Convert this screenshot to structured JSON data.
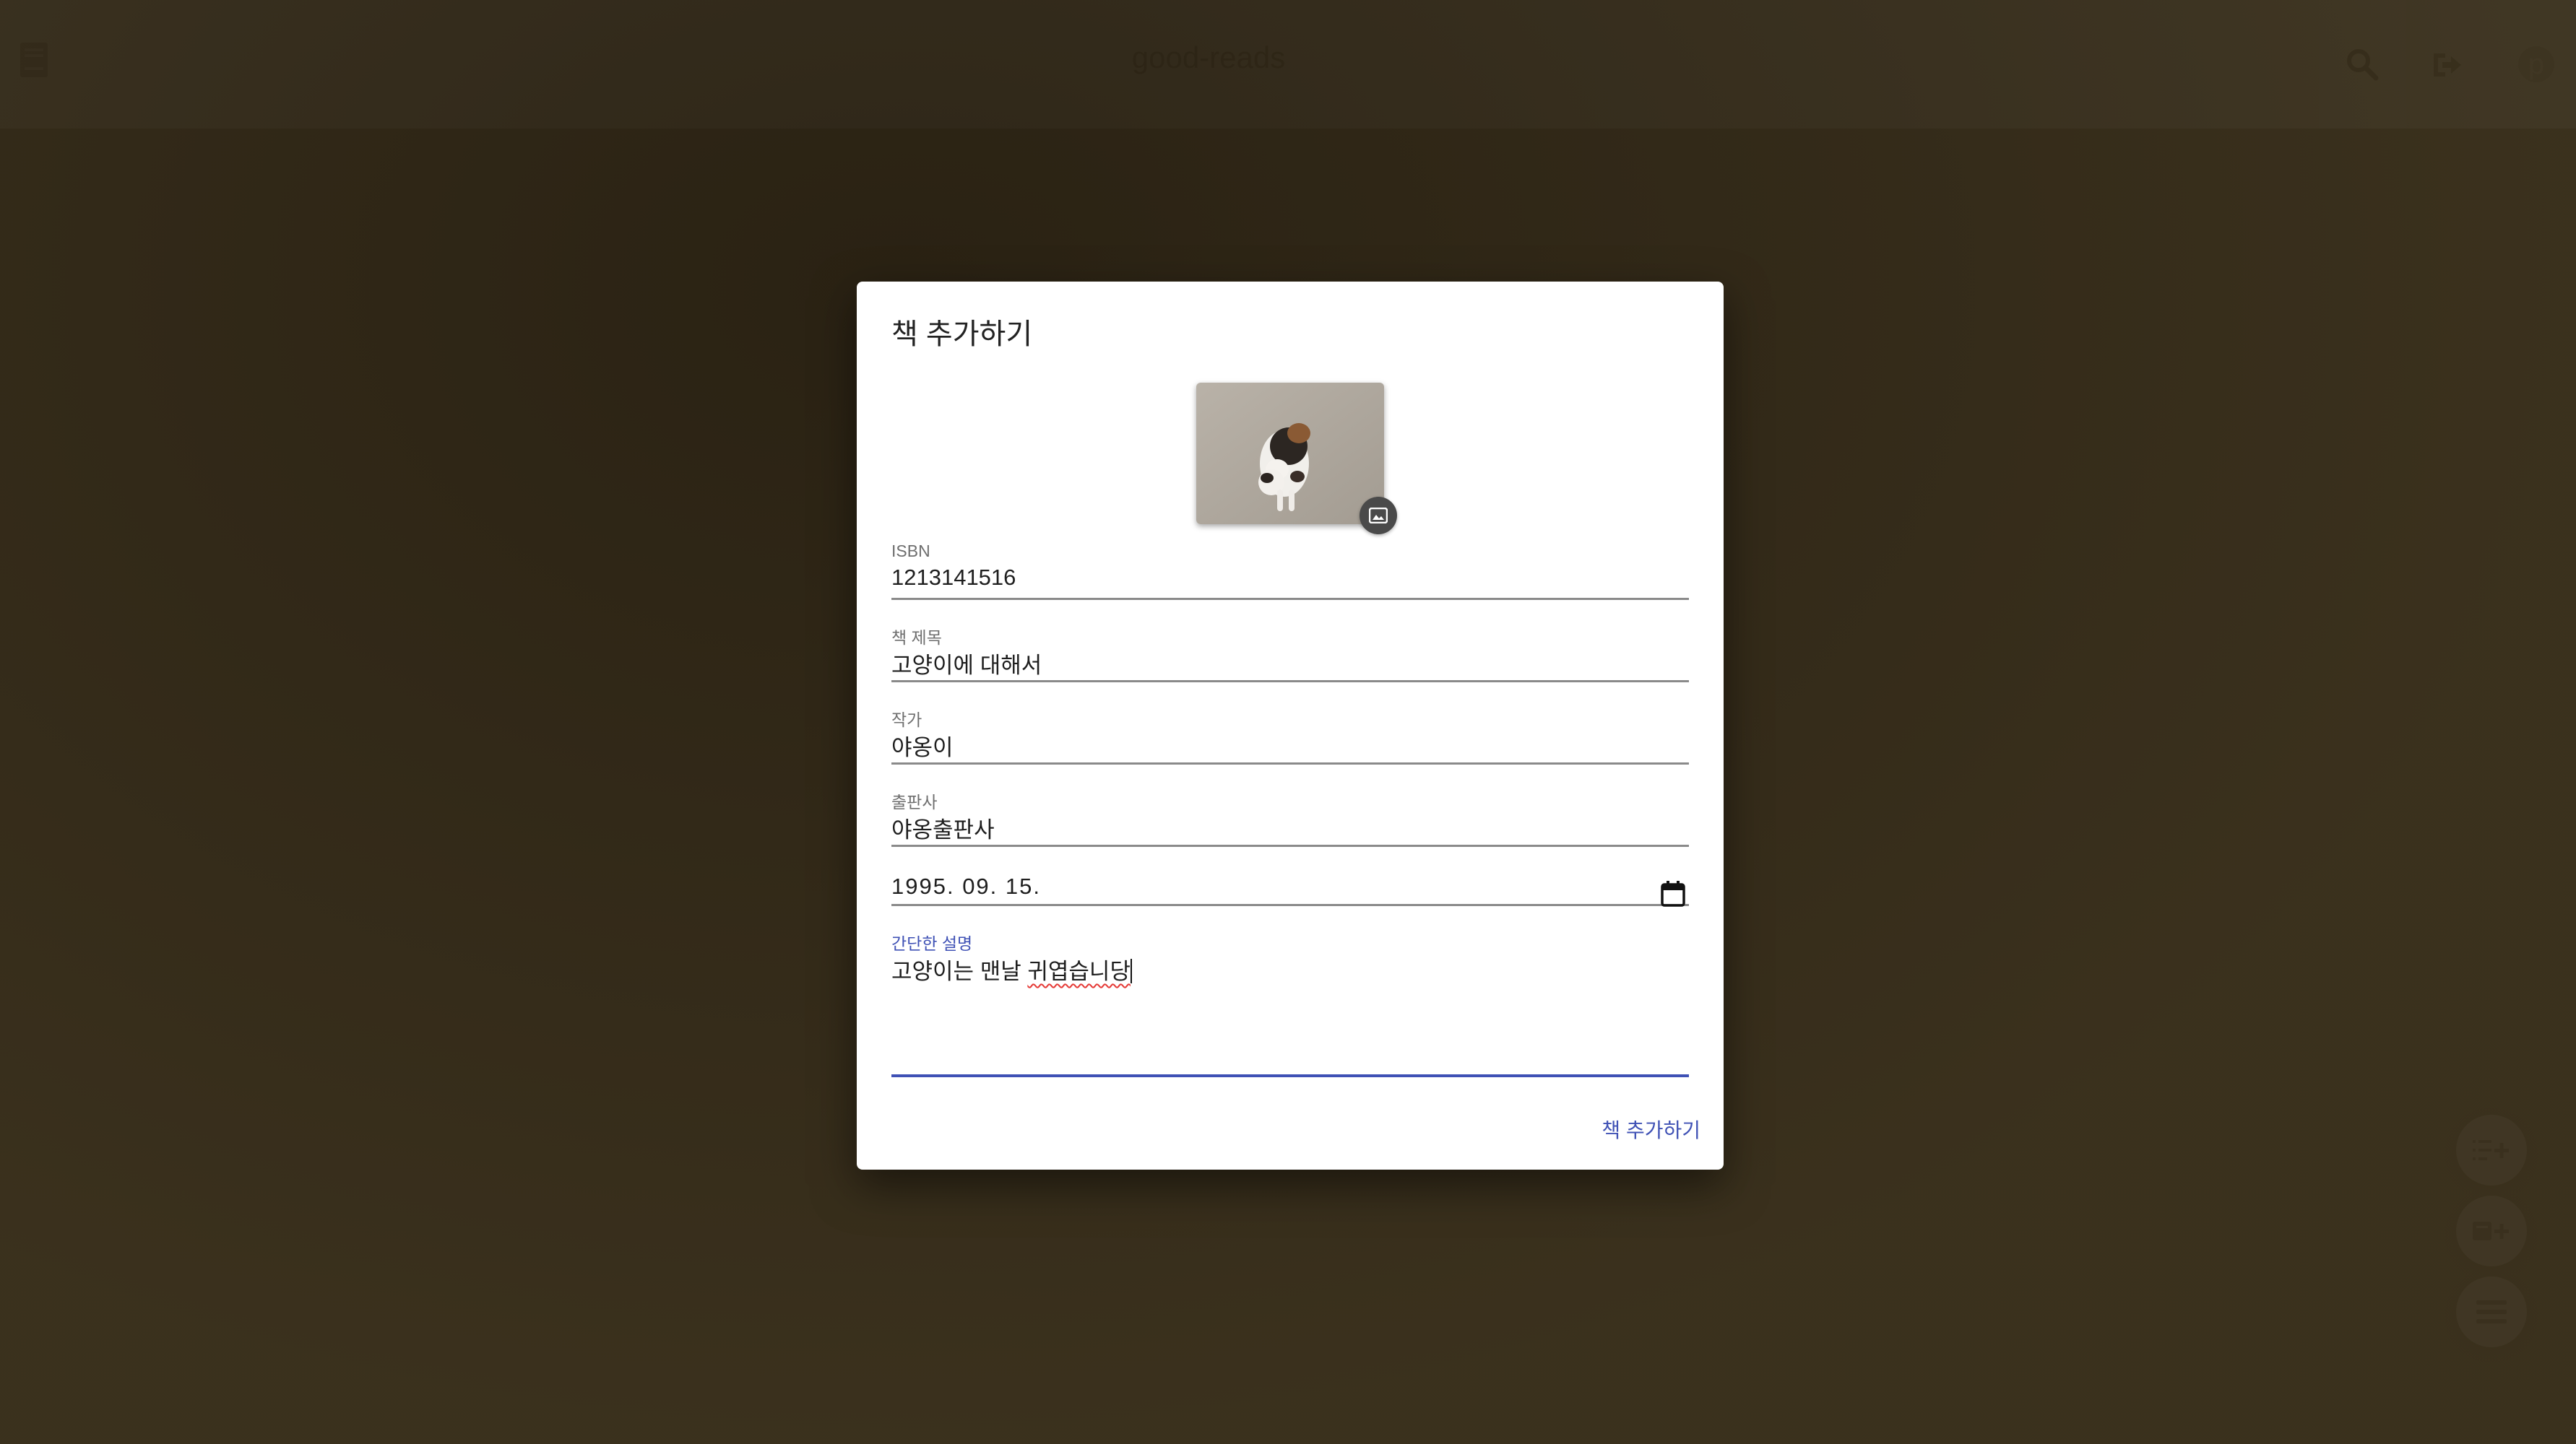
{
  "app_bar": {
    "title": "good-reads",
    "avatar_letter": "p",
    "icons": {
      "home": "book-icon",
      "search": "search-icon",
      "logout": "logout-icon"
    }
  },
  "dialog": {
    "title": "책 추가하기",
    "cover_image": "cat-photo",
    "cover_edit_icon": "image-icon",
    "fields": {
      "isbn": {
        "label": "ISBN",
        "value": "1213141516"
      },
      "book_title": {
        "label": "책 제목",
        "value": "고양이에 대해서"
      },
      "author": {
        "label": "작가",
        "value": "야옹이"
      },
      "publisher": {
        "label": "출판사",
        "value": "야옹출판사"
      },
      "publish_date": {
        "value": "1995. 09. 15."
      },
      "description": {
        "label": "간단한 설명",
        "value_plain": "고양이는 맨날 ",
        "value_misspelled": "귀엽습니당"
      }
    },
    "submit_label": "책 추가하기"
  },
  "fabs": [
    {
      "icon": "playlist-add-icon"
    },
    {
      "icon": "add-book-icon"
    },
    {
      "icon": "menu-icon"
    }
  ],
  "colors": {
    "accent": "#3f51b5",
    "scrim": "#2d2414"
  }
}
